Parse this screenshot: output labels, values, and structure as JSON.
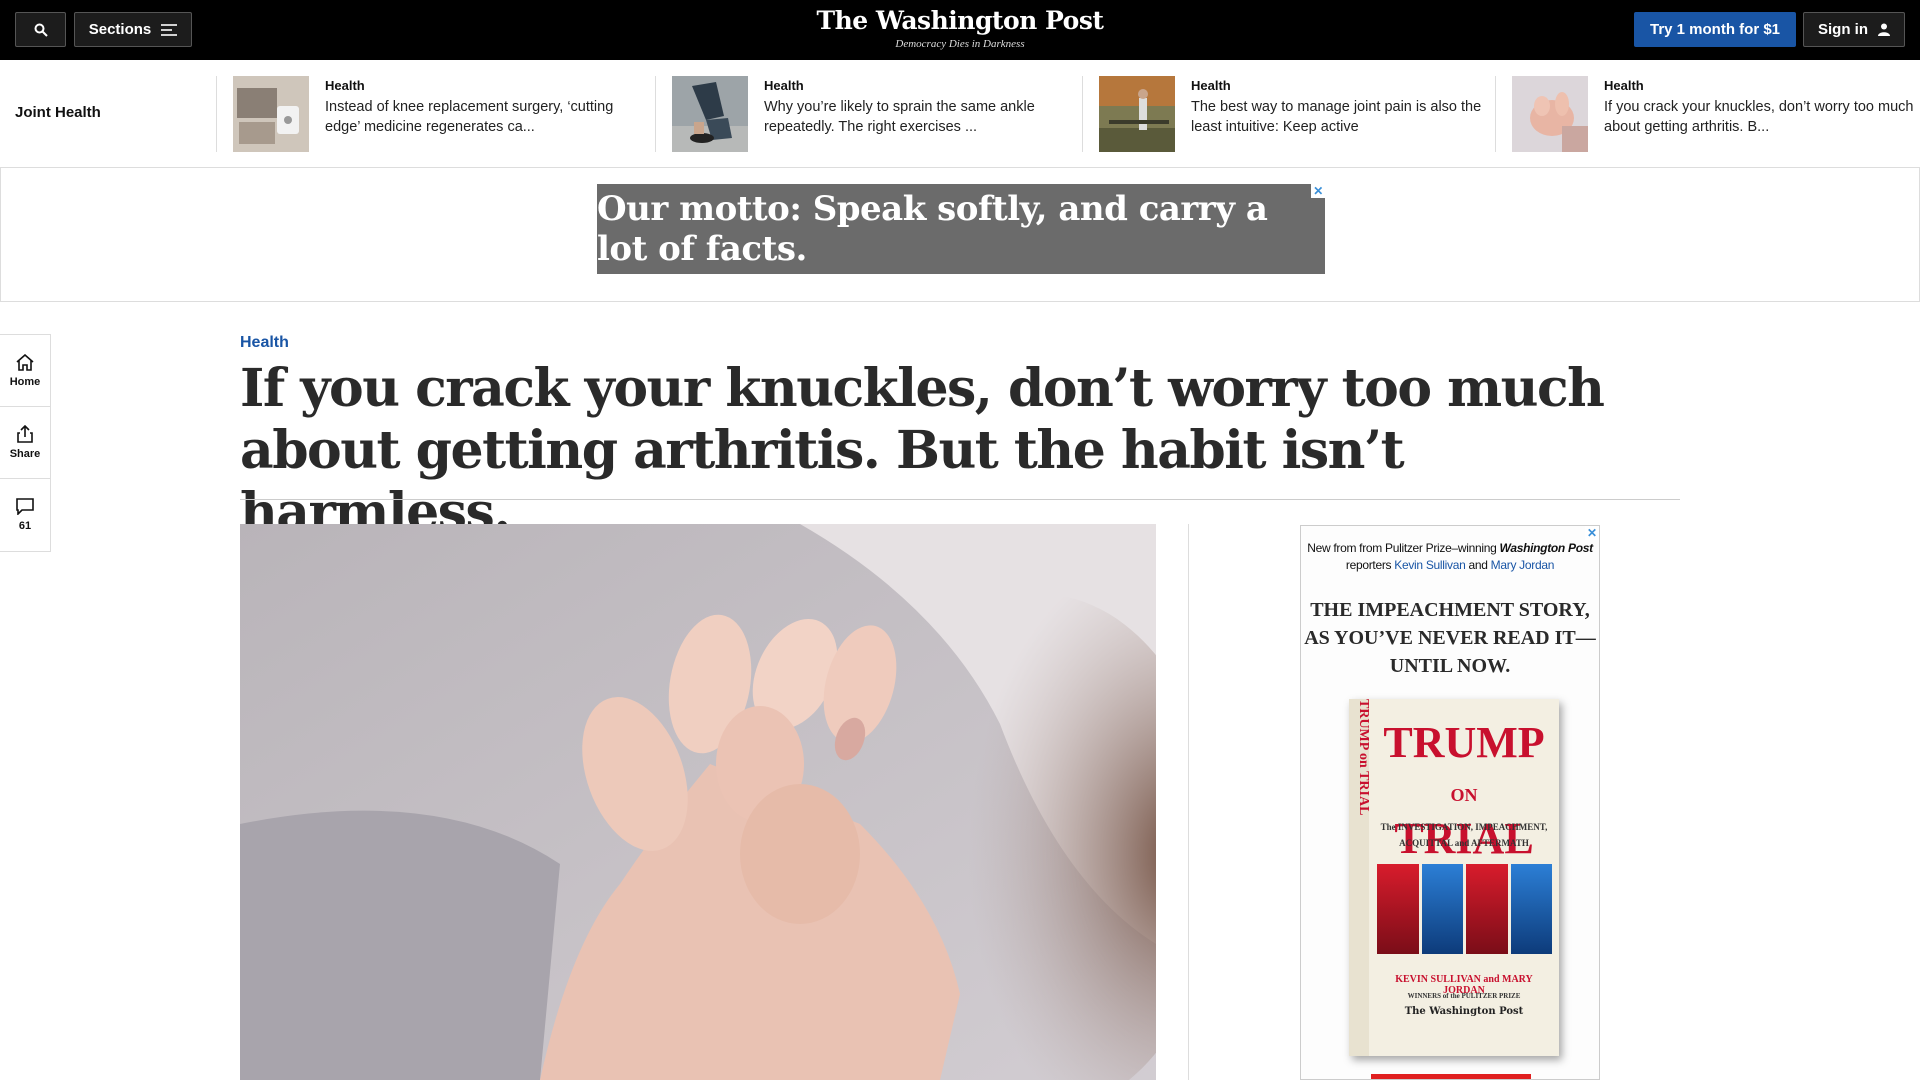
{
  "header": {
    "sections_label": "Sections",
    "logo": "The Washington Post",
    "tagline": "Democracy Dies in Darkness",
    "trial_button": "Try 1 month for $1",
    "signin_button": "Sign in"
  },
  "strip": {
    "label": "Joint Health",
    "items": [
      {
        "kicker": "Health",
        "headline": "Instead of knee replacement surgery, ‘cutting edge’ medicine regenerates ca..."
      },
      {
        "kicker": "Health",
        "headline": "Why you’re likely to sprain the same ankle repeatedly. The right exercises ..."
      },
      {
        "kicker": "Health",
        "headline": "The best way to manage joint pain is also the least intuitive: Keep active"
      },
      {
        "kicker": "Health",
        "headline": "If you crack your knuckles, don’t worry too much about getting arthritis. B..."
      }
    ]
  },
  "banner_ad": {
    "text": "Our motto: Speak softly, and carry a lot of facts.",
    "close": "✕"
  },
  "rail": {
    "home": "Home",
    "share": "Share",
    "comments": "61"
  },
  "article": {
    "kicker": "Health",
    "headline": "If you crack your knuckles, don’t worry too much about getting arthritis. But the habit isn’t harmless."
  },
  "side_ad": {
    "close": "✕",
    "line1_pre": "New from from Pulitzer Prize–winning ",
    "line1_pub": "Washington Post",
    "line2_pre": "reporters ",
    "author1": "Kevin Sullivan",
    "and": " and ",
    "author2": "Mary Jordan",
    "headline": "THE IMPEACHMENT STORY, AS YOU’VE NEVER READ IT— UNTIL NOW.",
    "book_title_1": "TRUMP",
    "book_title_on": "ON",
    "book_title_2": "TRIAL",
    "book_subtitle": "The INVESTIGATION, IMPEACHMENT, ACQUITTAL and AFTERMATH",
    "book_authors": "KEVIN SULLIVAN and MARY JORDAN",
    "book_winners": "WINNERS of the PULITZER PRIZE",
    "book_logo": "The Washington Post",
    "spine_text": "TRUMP on TRIAL"
  }
}
